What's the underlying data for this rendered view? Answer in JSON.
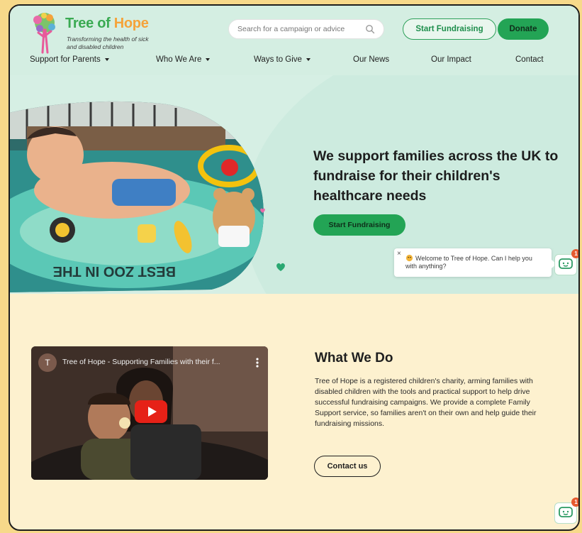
{
  "brand": {
    "name_part1": "Tree of ",
    "name_part2": "Hope",
    "tagline": "Transforming the health of sick and disabled children",
    "logo_icon": "tree-logo-icon",
    "colors": {
      "green": "#3aaa52",
      "orange": "#f5a33a",
      "header_bg": "#d4eee2",
      "cream": "#fdf1cf"
    }
  },
  "header": {
    "search_placeholder": "Search for a campaign or advice",
    "start_fundraising": "Start Fundraising",
    "donate": "Donate"
  },
  "nav": {
    "items": [
      {
        "label": "Support for Parents",
        "dropdown": true
      },
      {
        "label": "Who We Are",
        "dropdown": true
      },
      {
        "label": "Ways to Give",
        "dropdown": true
      },
      {
        "label": "Our News",
        "dropdown": false
      },
      {
        "label": "Our Impact",
        "dropdown": false
      },
      {
        "label": "Contact",
        "dropdown": false
      }
    ]
  },
  "hero": {
    "headline": "We support families across the UK to fundraise for their children's healthcare needs",
    "cta": "Start Fundraising"
  },
  "chat": {
    "message": "Welcome to Tree of Hope. Can I help you with anything?",
    "close": "×",
    "badge_count": "1"
  },
  "video": {
    "channel_initial": "T",
    "title": "Tree of Hope - Supporting Families with their f..."
  },
  "what_we_do": {
    "title": "What We Do",
    "body": "Tree of Hope is a registered children's charity, arming families with disabled children with the tools and practical support to help drive successful fundraising campaigns. We provide a complete Family Support service, so families aren't on their own and help guide their fundraising missions.",
    "cta": "Contact us"
  }
}
